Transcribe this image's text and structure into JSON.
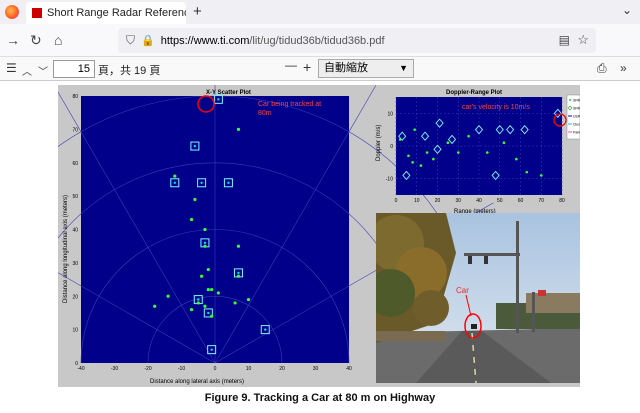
{
  "browser": {
    "tab_title": "Short Range Radar Reference",
    "tab_close": "✕",
    "new_tab": "+",
    "tabs_menu": "⌄",
    "url_domain": "https://www.ti.com",
    "url_path": "/lit/ug/tidud36b/tidud36b.pdf"
  },
  "pdf_toolbar": {
    "page_number": "15",
    "page_count_text": "頁，共 19 頁",
    "zoom_minus": "—",
    "zoom_plus": "+",
    "zoom_value": "自動縮放"
  },
  "figure": {
    "caption": "Figure 9. Tracking a Car at 80 m on Highway",
    "scatter": {
      "title": "X-Y Scatter Plot",
      "xlabel": "Distance along lateral axis (meters)",
      "ylabel": "Distance along longitudinal axis (meters)",
      "annotation": "Car being tracked at 80m",
      "x_ticks": [
        "-40",
        "-30",
        "-20",
        "-10",
        "0",
        "10",
        "20",
        "30",
        "40"
      ],
      "y_ticks": [
        "0",
        "10",
        "20",
        "30",
        "40",
        "50",
        "60",
        "70",
        "80"
      ]
    },
    "doppler": {
      "title": "Doppler-Range Plot",
      "xlabel": "Range (meters)",
      "ylabel": "Doppler (m/s)",
      "annotation": "car's velocity is 10m/s",
      "x_ticks": [
        "0",
        "10",
        "20",
        "30",
        "40",
        "50",
        "60",
        "70",
        "80"
      ],
      "y_ticks": [
        "-10",
        "0",
        "10"
      ]
    },
    "legend": {
      "items": [
        "SRR (dt)",
        "SRR Tracks",
        "USRR (dt)",
        "Clusters",
        "Park Assist Grid"
      ]
    },
    "photo": {
      "car_label": "Car"
    }
  },
  "chart_data": [
    {
      "type": "scatter",
      "title": "X-Y Scatter Plot",
      "xlabel": "Distance along lateral axis (meters)",
      "ylabel": "Distance along longitudinal axis (meters)",
      "xlim": [
        -40,
        40
      ],
      "ylim": [
        0,
        80
      ],
      "series": [
        {
          "name": "SRR Tracks",
          "x": [
            1,
            -6,
            -12,
            -4,
            4,
            -3,
            7,
            -5,
            -2,
            15,
            -1
          ],
          "y": [
            79,
            65,
            54,
            54,
            54,
            36,
            27,
            19,
            15,
            10,
            4
          ]
        },
        {
          "name": "SRR (dt)",
          "x": [
            7,
            -6,
            -7,
            -3,
            -12,
            -3,
            -4,
            -1,
            1,
            -14,
            -18,
            6,
            10,
            7,
            -2,
            7,
            -3,
            -7,
            -2,
            -5,
            -1
          ],
          "y": [
            70,
            49,
            43,
            40,
            56,
            35,
            26,
            22,
            21,
            20,
            17,
            18,
            19,
            26,
            28,
            35,
            17,
            16,
            22,
            18,
            14
          ]
        }
      ]
    },
    {
      "type": "scatter",
      "title": "Doppler-Range Plot",
      "xlabel": "Range (meters)",
      "ylabel": "Doppler (m/s)",
      "xlim": [
        0,
        80
      ],
      "ylim": [
        -15,
        15
      ],
      "series": [
        {
          "name": "SRR Tracks",
          "x": [
            78,
            21,
            3,
            14,
            40,
            50,
            27,
            55,
            62,
            20,
            48,
            5
          ],
          "y": [
            10,
            7,
            3,
            3,
            5,
            5,
            2,
            5,
            5,
            -1,
            -9,
            -9
          ]
        },
        {
          "name": "SRR (dt)",
          "x": [
            2,
            6,
            8,
            12,
            18,
            25,
            30,
            35,
            44,
            52,
            58,
            63,
            70,
            9,
            15
          ],
          "y": [
            2,
            -3,
            -5,
            -6,
            -4,
            1,
            -2,
            3,
            -2,
            1,
            -4,
            -8,
            -9,
            5,
            -2
          ]
        }
      ]
    }
  ]
}
